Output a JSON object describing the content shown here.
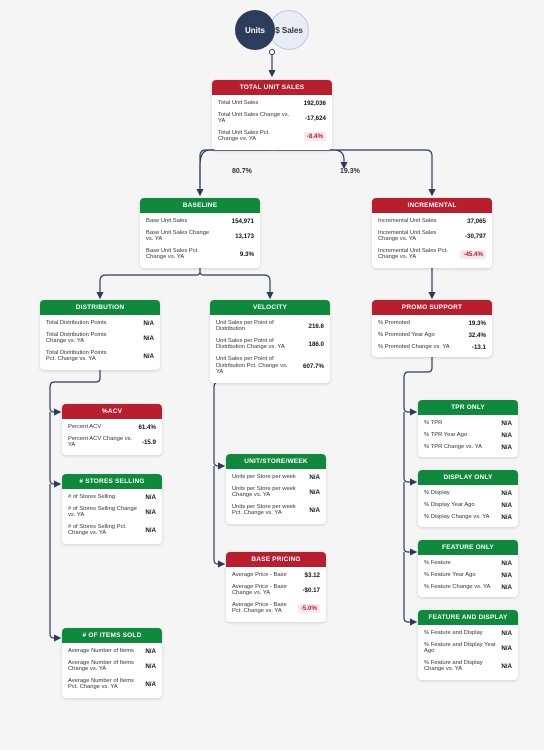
{
  "toggle": {
    "units": "Units",
    "sales": "$ Sales"
  },
  "split": {
    "baseline": "80.7%",
    "incremental": "19.3%"
  },
  "cards": {
    "total": {
      "title": "TOTAL UNIT SALES",
      "r1l": "Total Unit Sales",
      "r1v": "192,036",
      "r2l": "Total Unit Sales Change vs. YA",
      "r2v": "-17,624",
      "r3l": "Total Unit Sales Pct. Change vs. YA",
      "r3v": "-8.4%"
    },
    "baseline": {
      "title": "BASELINE",
      "r1l": "Base Unit Sales",
      "r1v": "154,971",
      "r2l": "Base Unit Sales Change vs. YA",
      "r2v": "13,173",
      "r3l": "Base Unit Sales Pct. Change vs. YA",
      "r3v": "9.3%"
    },
    "incremental": {
      "title": "INCREMENTAL",
      "r1l": "Incremental Unit Sales",
      "r1v": "37,065",
      "r2l": "Incremental Unit Sales Change vs. YA",
      "r2v": "-30,797",
      "r3l": "Incremental Unit Sales Pct. Change vs. YA",
      "r3v": "-45.4%"
    },
    "distribution": {
      "title": "DISTRIBUTION",
      "r1l": "Total Distribution Points",
      "r1v": "N/A",
      "r2l": "Total Distribution Points Change vs. YA",
      "r2v": "N/A",
      "r3l": "Total Distribution Points Pct. Change vs. YA",
      "r3v": "N/A"
    },
    "velocity": {
      "title": "VELOCITY",
      "r1l": "Unit Sales per Point of Distribution",
      "r1v": "216.6",
      "r2l": "Unit Sales per Point of Distribution Change vs. YA",
      "r2v": "186.0",
      "r3l": "Unit Sales per Point of Distribution Pct. Change vs. YA",
      "r3v": "607.7%"
    },
    "promo": {
      "title": "PROMO SUPPORT",
      "r1l": "% Promoted",
      "r1v": "19.3%",
      "r2l": "% Promoted Year Ago",
      "r2v": "32.4%",
      "r3l": "% Promoted Change vs. YA",
      "r3v": "-13.1"
    },
    "acv": {
      "title": "%ACV",
      "r1l": "Percent ACV",
      "r1v": "61.4%",
      "r2l": "Percent ACV Change vs. YA",
      "r2v": "-15.9"
    },
    "usw": {
      "title": "UNIT/STORE/WEEK",
      "r1l": "Units per Store per week",
      "r1v": "N/A",
      "r2l": "Units per Store per week Change vs. YA",
      "r2v": "N/A",
      "r3l": "Units per Store per week Pct. Change vs. YA",
      "r3v": "N/A"
    },
    "tpr": {
      "title": "TPR ONLY",
      "r1l": "% TPR",
      "r1v": "N/A",
      "r2l": "% TPR Year Ago",
      "r2v": "N/A",
      "r3l": "% TPR Change vs. YA",
      "r3v": "N/A"
    },
    "stores": {
      "title": "# STORES SELLING",
      "r1l": "# of Stores Selling",
      "r1v": "N/A",
      "r2l": "# of Stores Selling Change vs. YA",
      "r2v": "N/A",
      "r3l": "# of Stores Selling Pct. Change vs. YA",
      "r3v": "N/A"
    },
    "basep": {
      "title": "BASE PRICING",
      "r1l": "Average Price - Base",
      "r1v": "$3.12",
      "r2l": "Average Price - Base Change vs. YA",
      "r2v": "-$0.17",
      "r3l": "Average Price - Base Pct. Change vs. YA",
      "r3v": "-5.0%"
    },
    "display": {
      "title": "DISPLAY ONLY",
      "r1l": "% Display",
      "r1v": "N/A",
      "r2l": "% Display Year Ago",
      "r2v": "N/A",
      "r3l": "% Display Change vs. YA",
      "r3v": "N/A"
    },
    "feature": {
      "title": "FEATURE ONLY",
      "r1l": "% Feature",
      "r1v": "N/A",
      "r2l": "% Feature Year Ago",
      "r2v": "N/A",
      "r3l": "% Feature Change vs. YA",
      "r3v": "N/A"
    },
    "items": {
      "title": "# OF ITEMS SOLD",
      "r1l": "Average Number of Items",
      "r1v": "N/A",
      "r2l": "Average Number of Items Change vs. YA",
      "r2v": "N/A",
      "r3l": "Average Number of Items Pct. Change vs. YA",
      "r3v": "N/A"
    },
    "fd": {
      "title": "FEATURE AND DISPLAY",
      "r1l": "% Feature and Display",
      "r1v": "N/A",
      "r2l": "% Feature and Display Year Ago",
      "r2v": "N/A",
      "r3l": "% Feature and Display Change vs. YA",
      "r3v": "N/A"
    }
  }
}
